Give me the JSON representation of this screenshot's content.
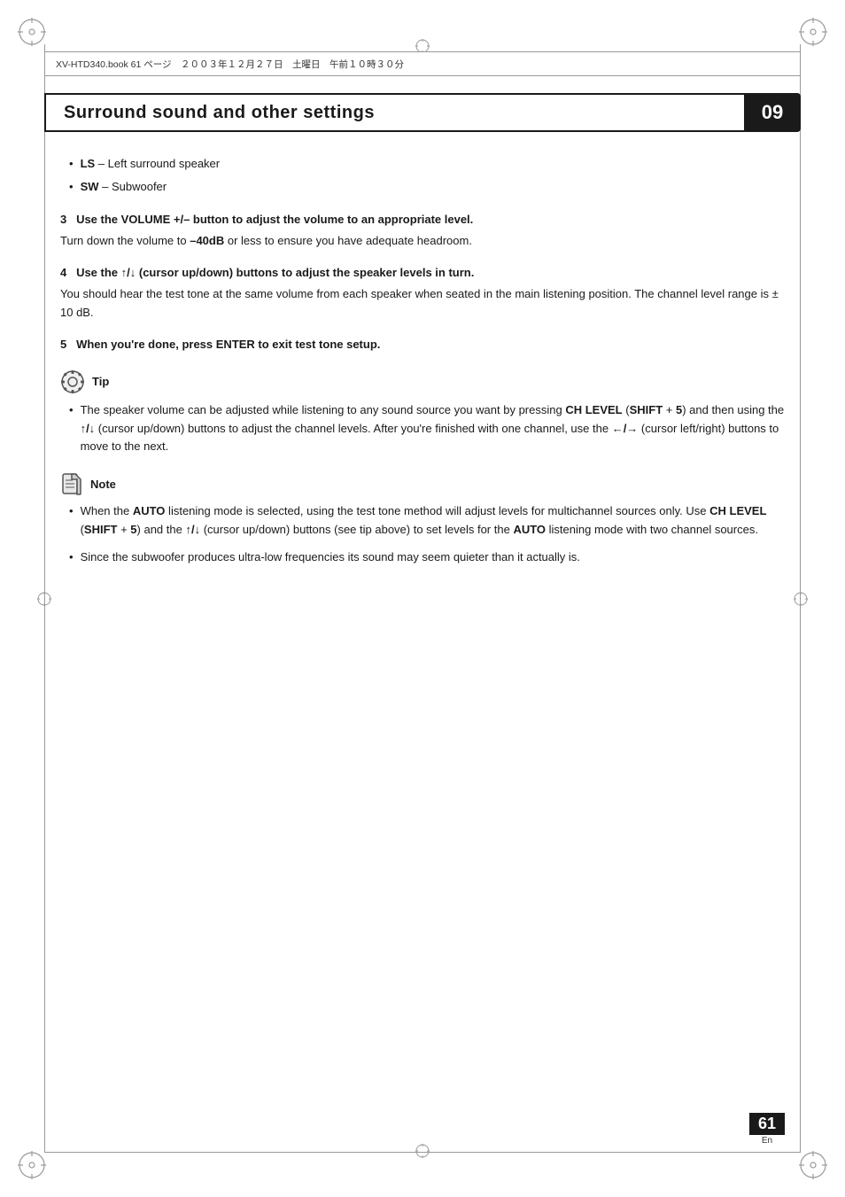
{
  "header": {
    "file_info": "XV-HTD340.book  61 ページ　２００３年１２月２７日　土曜日　午前１０時３０分"
  },
  "chapter": {
    "title": "Surround sound and other settings",
    "number": "09"
  },
  "content": {
    "bullet_items": [
      {
        "label": "LS",
        "separator": " – ",
        "text": "Left surround speaker"
      },
      {
        "label": "SW",
        "separator": " – ",
        "text": "Subwoofer"
      }
    ],
    "sections": [
      {
        "number": "3",
        "heading": "Use the VOLUME +/– button to adjust the volume to an appropriate level.",
        "body": "Turn down the volume to –40dB or less to ensure you have adequate headroom."
      },
      {
        "number": "4",
        "heading": "Use the ↑/↓ (cursor up/down) buttons to adjust the speaker levels in turn.",
        "body": "You should hear the test tone at the same volume from each speaker when seated in the main listening position. The channel level range is ± 10 dB."
      },
      {
        "number": "5",
        "heading": "When you're done, press ENTER to exit test tone setup.",
        "body": ""
      }
    ],
    "tip": {
      "title": "Tip",
      "bullets": [
        "The speaker volume can be adjusted while listening to any sound source you want by pressing CH LEVEL (SHIFT + 5) and then using the ↑/↓ (cursor up/down) buttons to adjust the channel levels. After you're finished with one channel, use the ←/→ (cursor left/right) buttons to move to the next."
      ]
    },
    "note": {
      "title": "Note",
      "bullets": [
        "When the AUTO listening mode is selected, using the test tone method will adjust levels for multichannel sources only. Use CH LEVEL (SHIFT + 5) and the ↑/↓ (cursor up/down) buttons (see tip above) to set levels for the AUTO listening mode with two channel sources.",
        "Since the subwoofer produces ultra-low frequencies its sound may seem quieter than it actually is."
      ]
    }
  },
  "page": {
    "number": "61",
    "lang": "En"
  }
}
